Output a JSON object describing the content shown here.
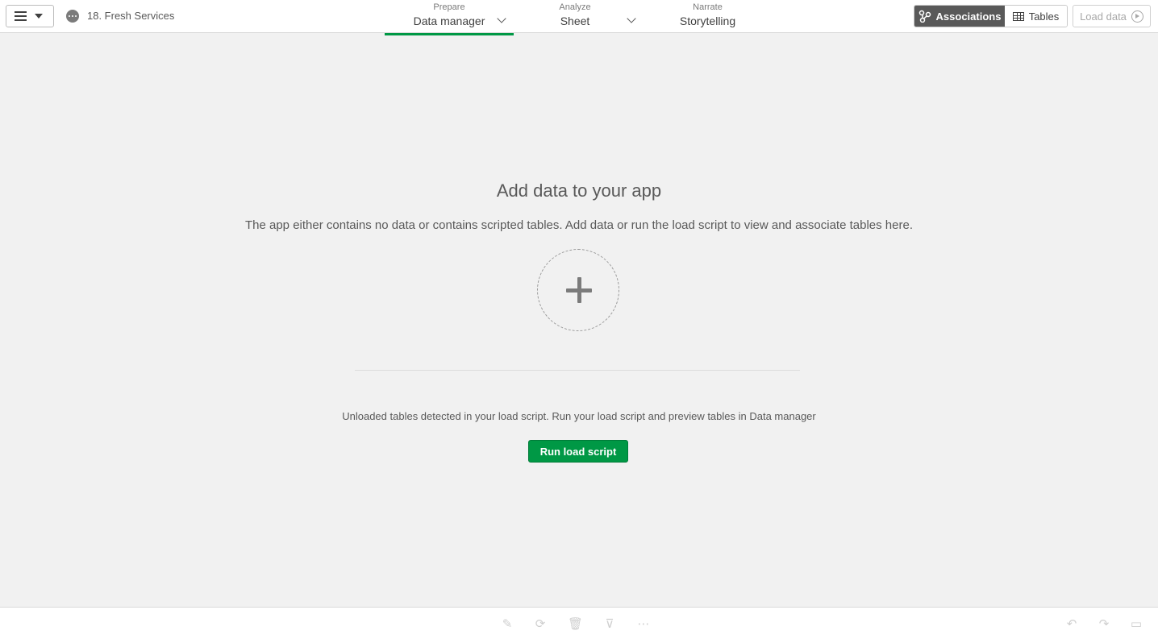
{
  "header": {
    "app_title": "18. Fresh Services",
    "nav": [
      {
        "small": "Prepare",
        "main": "Data manager"
      },
      {
        "small": "Analyze",
        "main": "Sheet"
      },
      {
        "small": "Narrate",
        "main": "Storytelling"
      }
    ],
    "associations_label": "Associations",
    "tables_label": "Tables",
    "load_data_label": "Load data"
  },
  "main": {
    "heading": "Add data to your app",
    "description": "The app either contains no data or contains scripted tables. Add data or run the load script to view and associate tables here.",
    "notice": "Unloaded tables detected in your load script. Run your load script and preview tables in Data manager",
    "run_button_label": "Run load script"
  },
  "colors": {
    "accent_green": "#009845",
    "dark_gray": "#595959",
    "background": "#f1f1f1"
  },
  "icons": [
    "menu-icon",
    "app-icon",
    "associations-icon",
    "tables-icon",
    "play-icon",
    "add-icon",
    "edit-icon",
    "refresh-icon",
    "delete-icon",
    "clear-filter-icon",
    "more-icon",
    "undo-icon",
    "redo-icon",
    "panel-icon"
  ]
}
